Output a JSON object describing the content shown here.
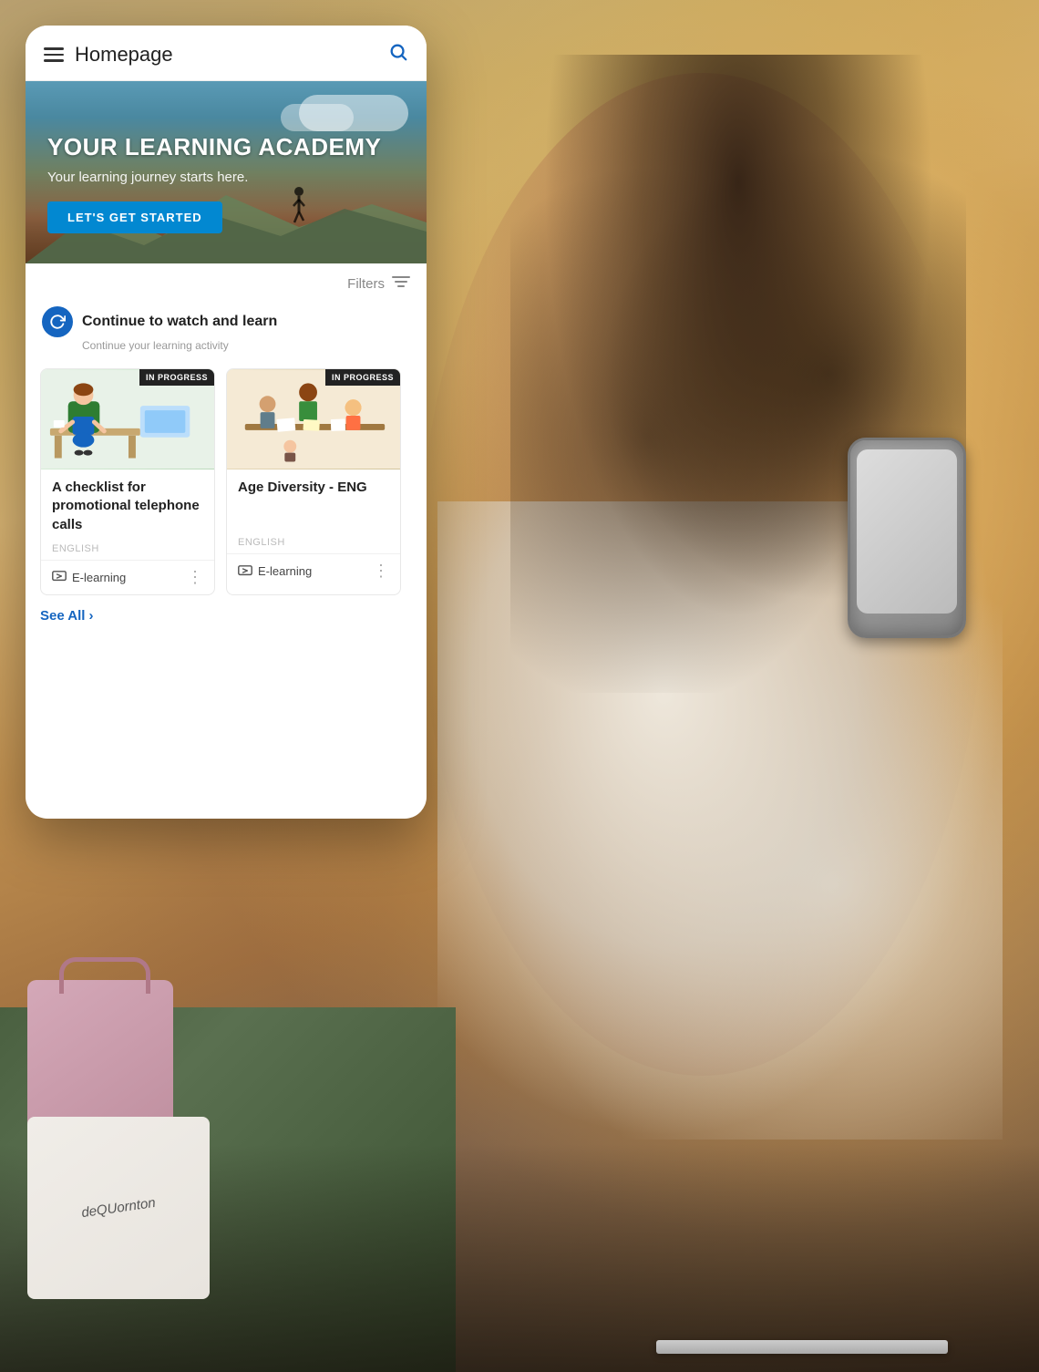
{
  "background": {
    "colors": {
      "warm_amber": "#c8a060",
      "dark_brown": "#4a3020",
      "green": "#4a6040"
    }
  },
  "app": {
    "header": {
      "title": "Homepage",
      "search_label": "search"
    },
    "hero": {
      "title": "YOUR LEARNING ACADEMY",
      "subtitle": "Your learning journey starts here.",
      "cta_button": "LET'S GET STARTED"
    },
    "filters": {
      "label": "Filters"
    },
    "section": {
      "title": "Continue to watch and learn",
      "subtitle": "Continue your learning activity",
      "icon": "↻"
    },
    "courses": [
      {
        "title": "A checklist for promotional telephone calls",
        "badge": "IN PROGRESS",
        "language": "ENGLISH",
        "type": "E-learning",
        "image_type": "office"
      },
      {
        "title": "Age Diversity - ENG",
        "badge": "IN PROGRESS",
        "language": "ENGLISH",
        "type": "E-learning",
        "image_type": "diversity"
      }
    ],
    "see_all": {
      "label": "See All",
      "arrow": "›"
    }
  },
  "bags": {
    "brand_text": "deQUornton"
  }
}
